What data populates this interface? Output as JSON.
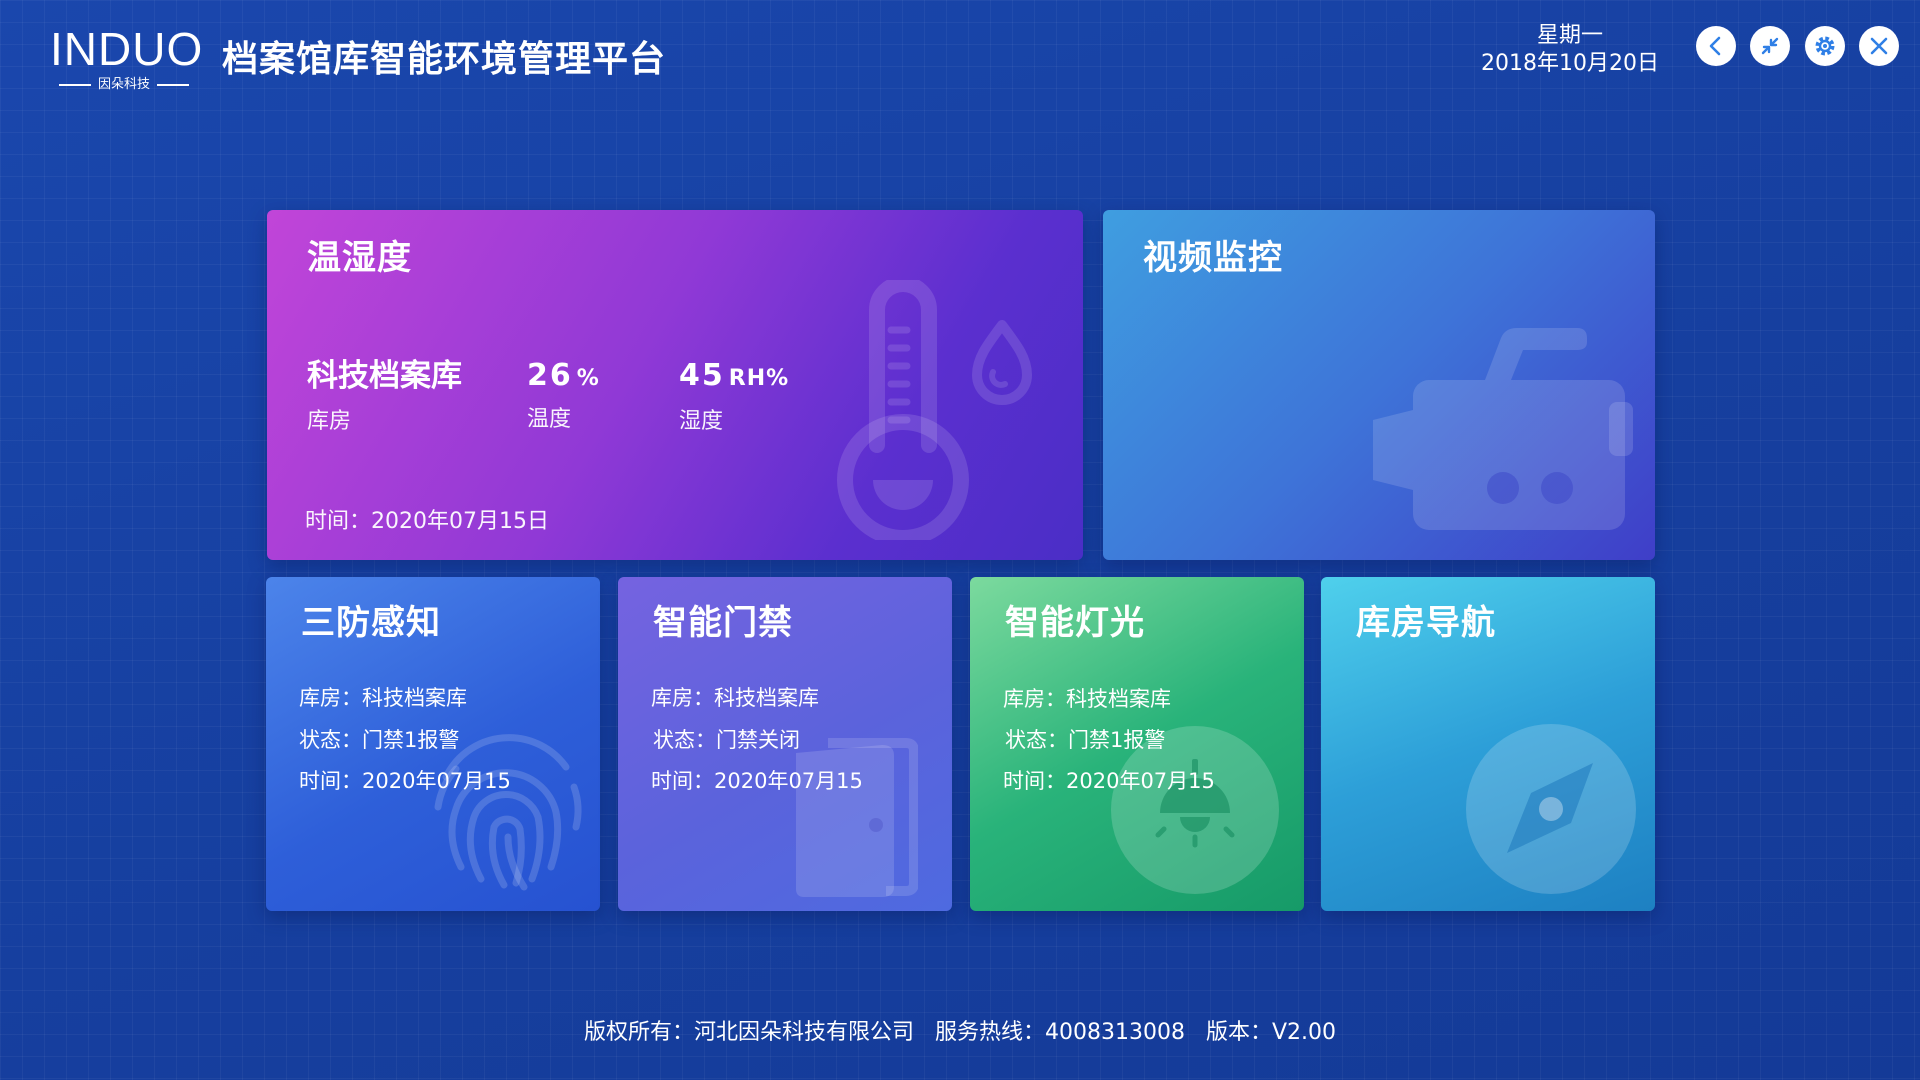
{
  "header": {
    "logo_text": "INDUO",
    "logo_sub": "因朵科技",
    "title": "档案馆库智能环境管理平台",
    "weekday": "星期一",
    "date": "2018年10月20日",
    "buttons": [
      {
        "icon": "chevron-left-icon"
      },
      {
        "icon": "shrink-icon"
      },
      {
        "icon": "gear-icon"
      },
      {
        "icon": "close-icon"
      }
    ]
  },
  "cards": {
    "temp_humidity": {
      "title": "温湿度",
      "room_name": "科技档案库",
      "room_label": "库房",
      "reading1_value": "26",
      "reading1_unit": "%",
      "reading1_label": "温度",
      "reading2_value": "45",
      "reading2_unit": "RH%",
      "reading2_label": "湿度",
      "time": "时间：2020年07月15日",
      "icons": [
        "thermometer-icon",
        "water-drop-icon"
      ]
    },
    "video": {
      "title": "视频监控",
      "icon": "video-camera-icon"
    },
    "defense": {
      "title": "三防感知",
      "lines": [
        "库房：科技档案库",
        "状态：门禁1报警",
        "时间：2020年07月15"
      ],
      "icon": "fingerprint-icon"
    },
    "door": {
      "title": "智能门禁",
      "lines": [
        "库房：科技档案库",
        "状态：门禁关闭",
        "时间：2020年07月15"
      ],
      "icon": "door-icon"
    },
    "light": {
      "title": "智能灯光",
      "lines": [
        "库房：科技档案库",
        "状态：门禁1报警",
        "时间：2020年07月15"
      ],
      "icon": "lamp-icon"
    },
    "nav": {
      "title": "库房导航",
      "icon": "compass-icon"
    }
  },
  "footer": {
    "copyright": "版权所有：河北因朵科技有限公司",
    "hotline": "服务热线：4008313008",
    "version": "版本：V2.00"
  },
  "colors": {
    "background": "#1741a3",
    "button_icon": "#2f7fe6"
  }
}
